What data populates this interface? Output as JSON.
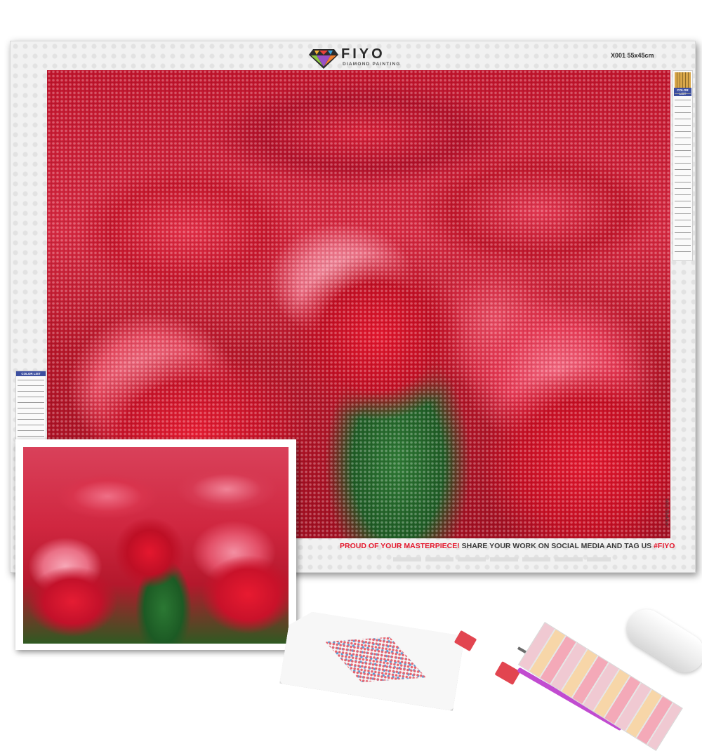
{
  "brand": {
    "name": "FIYO",
    "tagline": "DIAMOND PAINTING"
  },
  "canvas": {
    "size_label": "X001 55x45cm",
    "side_code": "X001 55x45cm"
  },
  "color_list": {
    "right_title": "COLOR LIST",
    "left_title": "COLOR LIST"
  },
  "footer": {
    "highlight": "PROUD OF YOUR MASTERPIECE!",
    "message": " SHARE YOUR WORK ON SOCIAL MEDIA AND TAG US ",
    "tag": "#FIYO"
  },
  "colors": {
    "accent_red": "#e4172c",
    "tulip_red": "#d01a30",
    "tulip_pink": "#f38fa2",
    "stem_green": "#2b7833",
    "list_header_blue": "#3c4fa0",
    "pen_purple": "#c14bd0"
  }
}
